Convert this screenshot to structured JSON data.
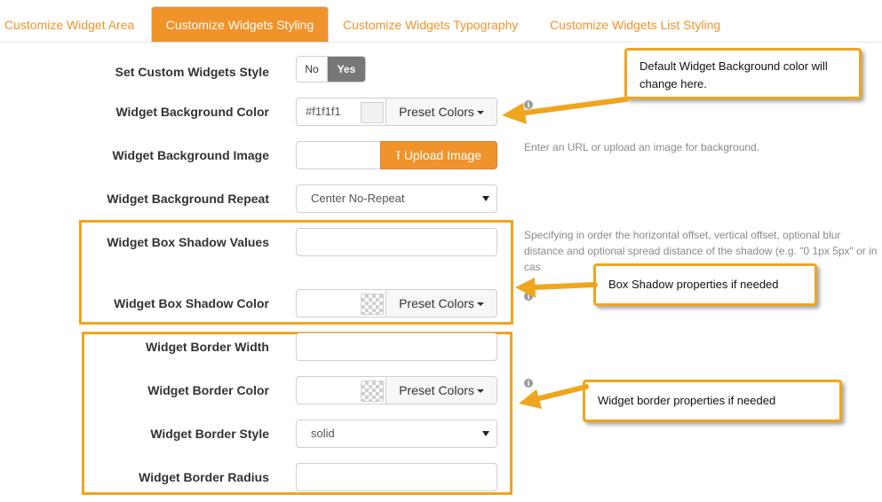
{
  "tabs": [
    {
      "label": "Customize Widget Area"
    },
    {
      "label": "Customize Widgets Styling"
    },
    {
      "label": "Customize Widgets Typography"
    },
    {
      "label": "Customize Widgets List Styling"
    }
  ],
  "form": {
    "custom_style": {
      "label": "Set Custom Widgets Style",
      "no": "No",
      "yes": "Yes"
    },
    "bg_color": {
      "label": "Widget Background Color",
      "value": "#f1f1f1",
      "preset": "Preset Colors"
    },
    "bg_image": {
      "label": "Widget Background Image",
      "upload": "Upload Image",
      "help": "Enter an URL or upload an image for background."
    },
    "bg_repeat": {
      "label": "Widget Background Repeat",
      "value": "Center No-Repeat"
    },
    "shadow_values": {
      "label": "Widget Box Shadow Values",
      "help": "Specifying in order the horizontal offset, vertical offset, optional blur distance and optional spread distance of the shadow (e.g. \"0 1px 5px\" or in cas"
    },
    "shadow_color": {
      "label": "Widget Box Shadow Color",
      "preset": "Preset Colors"
    },
    "border_width": {
      "label": "Widget Border Width"
    },
    "border_color": {
      "label": "Widget Border Color",
      "preset": "Preset Colors"
    },
    "border_style": {
      "label": "Widget Border Style",
      "value": "solid"
    },
    "border_radius": {
      "label": "Widget Border Radius"
    }
  },
  "callouts": {
    "bg": "Default Widget Background color will change here.",
    "shadow": "Box Shadow properties if needed",
    "border": "Widget border properties if needed"
  },
  "colors": {
    "accent": "#f0932b",
    "annotation": "#f0a51e",
    "bg_swatch": "#f1f1f1"
  }
}
